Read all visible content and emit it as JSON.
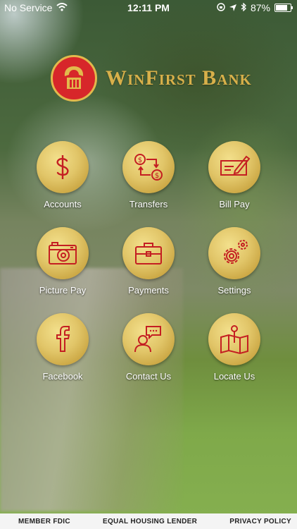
{
  "status": {
    "carrier": "No Service",
    "time": "12:11 PM",
    "battery": "87%",
    "battery_level": 0.87
  },
  "brand": {
    "name": "WinFirst Bank"
  },
  "menu": [
    {
      "label": "Accounts",
      "icon": "dollar-icon"
    },
    {
      "label": "Transfers",
      "icon": "transfer-icon"
    },
    {
      "label": "Bill Pay",
      "icon": "check-icon"
    },
    {
      "label": "Picture Pay",
      "icon": "camera-icon"
    },
    {
      "label": "Payments",
      "icon": "briefcase-icon"
    },
    {
      "label": "Settings",
      "icon": "gear-icon"
    },
    {
      "label": "Facebook",
      "icon": "facebook-icon"
    },
    {
      "label": "Contact Us",
      "icon": "chat-person-icon"
    },
    {
      "label": "Locate Us",
      "icon": "map-pin-icon"
    }
  ],
  "footer": {
    "fdic": "MEMBER FDIC",
    "housing": "EQUAL HOUSING LENDER",
    "privacy": "PRIVACY POLICY"
  },
  "colors": {
    "icon_red": "#c41e22",
    "gold": "#d8b04a"
  }
}
